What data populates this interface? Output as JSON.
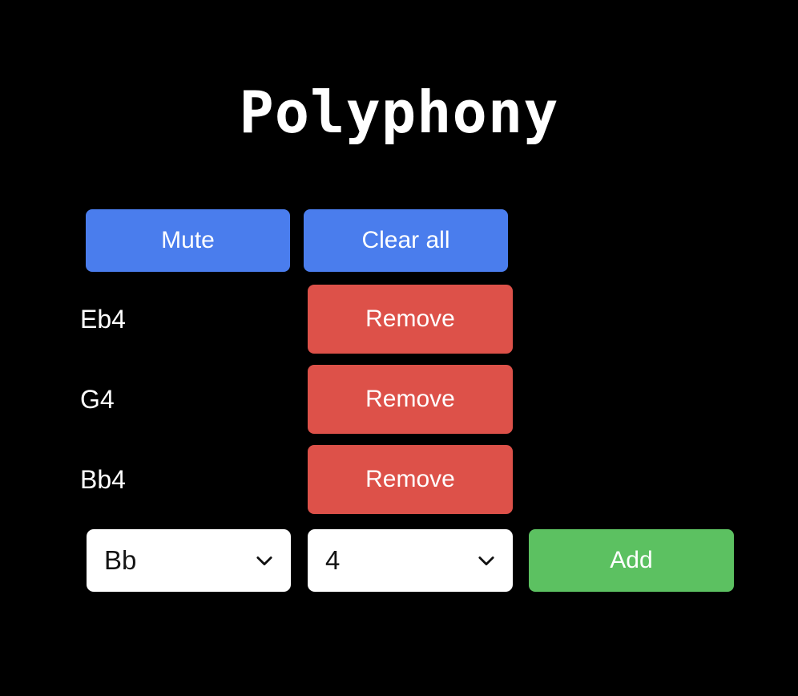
{
  "app": {
    "title": "Polyphony",
    "background_color": "#000000"
  },
  "colors": {
    "blue": "#4a7ded",
    "red": "#dd5149",
    "green": "#5cc161",
    "text_light": "#ffffff",
    "text_dark": "#141414",
    "select_background": "#ffffff"
  },
  "toolbar": {
    "mute_label": "Mute",
    "clear_all_label": "Clear all"
  },
  "voices": [
    {
      "note": "Eb4",
      "remove_label": "Remove"
    },
    {
      "note": "G4",
      "remove_label": "Remove"
    },
    {
      "note": "Bb4",
      "remove_label": "Remove"
    }
  ],
  "add_row": {
    "note_select": {
      "value": "Bb",
      "icon": "chevron-down-icon"
    },
    "octave_select": {
      "value": "4",
      "icon": "chevron-down-icon"
    },
    "add_label": "Add"
  }
}
